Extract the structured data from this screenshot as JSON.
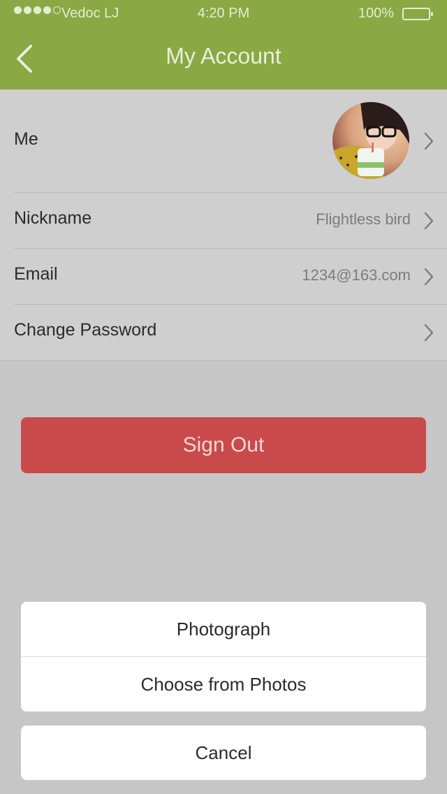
{
  "status_bar": {
    "carrier": "Vedoc LJ",
    "time": "4:20 PM",
    "battery": "100%",
    "signal_bars_filled": 4,
    "signal_bars_total": 5
  },
  "nav": {
    "title": "My Account",
    "back_icon": "chevron-left-icon"
  },
  "account": {
    "me_label": "Me",
    "nickname_label": "Nickname",
    "nickname_value": "Flightless bird",
    "email_label": "Email",
    "email_value": "1234@163.com",
    "password_label": "Change Password"
  },
  "sign_out_label": "Sign Out",
  "action_sheet": {
    "photograph_label": "Photograph",
    "choose_label": "Choose from Photos",
    "cancel_label": "Cancel"
  },
  "colors": {
    "header": "#8aa843",
    "sign_out": "#c94a4a",
    "overlay": "#c6c6c6"
  }
}
